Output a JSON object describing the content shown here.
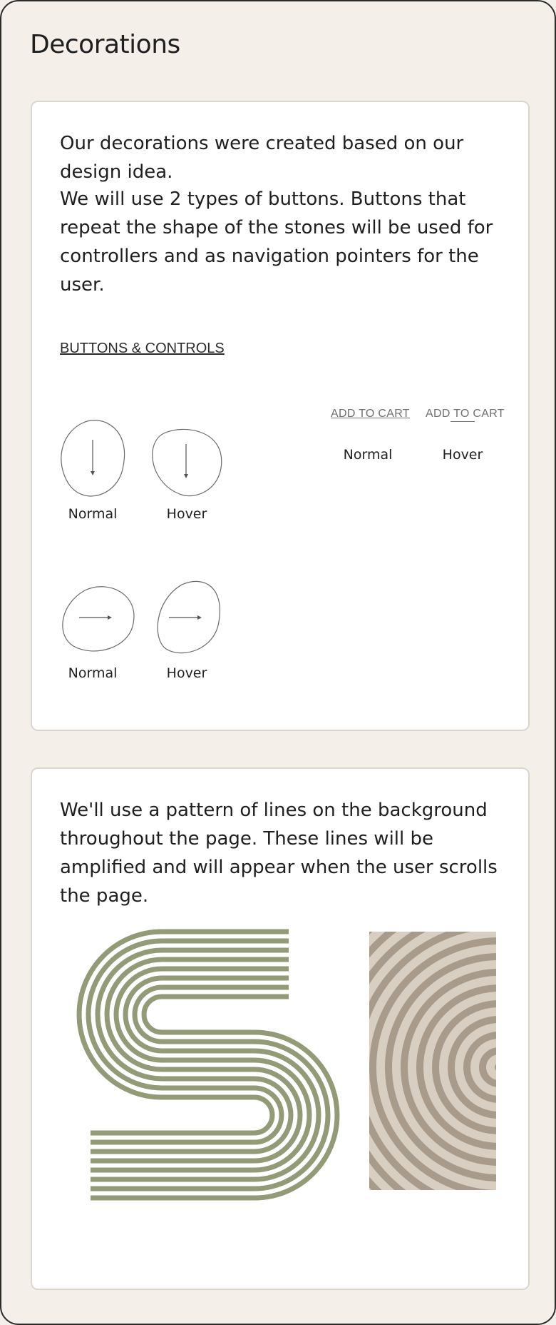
{
  "page": {
    "title": "Decorations"
  },
  "card1": {
    "paragraph1": "Our decorations were created based on our design idea.",
    "paragraph2": "We will use 2 types of buttons. Buttons that repeat the shape of the stones will be used for controllers and as navigation pointers for the user.",
    "section_link": "BUTTONS & CONTROLS",
    "stone_buttons": {
      "down": {
        "icon": "arrow-down-icon",
        "normal_label": "Normal",
        "hover_label": "Hover"
      },
      "right": {
        "icon": "arrow-right-icon",
        "normal_label": "Normal",
        "hover_label": "Hover"
      }
    },
    "text_buttons": {
      "label": "ADD TO CART",
      "normal_label": "Normal",
      "hover_label": "Hover"
    }
  },
  "card2": {
    "paragraph": "We'll use a pattern of lines on the background throughout the page. These lines will be amplified and will appear when the user scrolls the page.",
    "pattern_color": "#939a78",
    "sand_color": "#d8cfc2"
  },
  "colors": {
    "background": "#f4f0e9",
    "card": "#ffffff",
    "text": "#1f1f1f",
    "muted": "#707070"
  }
}
